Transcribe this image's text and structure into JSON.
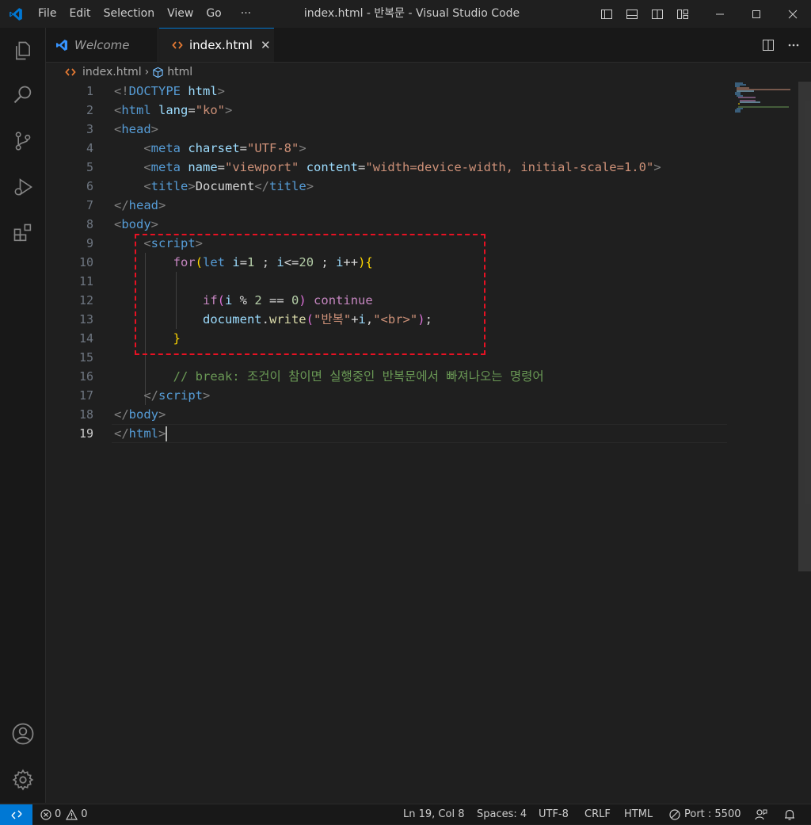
{
  "menu": {
    "file": "File",
    "edit": "Edit",
    "selection": "Selection",
    "view": "View",
    "go": "Go",
    "more": "···"
  },
  "window_title": "index.html - 반복문 - Visual Studio Code",
  "tabs": {
    "welcome": "Welcome",
    "index": "index.html",
    "close": "✕"
  },
  "breadcrumb": {
    "file": "index.html",
    "sep": "›",
    "symbol": "html"
  },
  "line_numbers": [
    "1",
    "2",
    "3",
    "4",
    "5",
    "6",
    "7",
    "8",
    "9",
    "10",
    "11",
    "12",
    "13",
    "14",
    "15",
    "16",
    "17",
    "18",
    "19"
  ],
  "code": {
    "l1": {
      "open": "<!",
      "doctype": "DOCTYPE",
      "html": "html",
      "close": ">"
    },
    "l2": {
      "open": "<",
      "tag": "html",
      "attr": "lang",
      "eq": "=",
      "val": "\"ko\"",
      "close": ">"
    },
    "l3": {
      "open": "<",
      "tag": "head",
      "close": ">"
    },
    "l4": {
      "open": "<",
      "tag": "meta",
      "attr": "charset",
      "eq": "=",
      "val": "\"UTF-8\"",
      "close": ">"
    },
    "l5": {
      "open": "<",
      "tag": "meta",
      "attr1": "name",
      "eq": "=",
      "val1": "\"viewport\"",
      "attr2": "content",
      "val2": "\"width=device-width, initial-scale=1.0\"",
      "close": ">"
    },
    "l6": {
      "open": "<",
      "tag": "title",
      "close": ">",
      "text": "Document",
      "open2": "</",
      "close2": ">"
    },
    "l7": {
      "open": "</",
      "tag": "head",
      "close": ">"
    },
    "l8": {
      "open": "<",
      "tag": "body",
      "close": ">"
    },
    "l9": {
      "open": "<",
      "tag": "script",
      "close": ">"
    },
    "l10": {
      "kw": "for",
      "lp": "(",
      "let": "let",
      "var": "i",
      "eq": "=",
      "n1": "1",
      "sep": " ; ",
      "var2": "i",
      "lte": "<=",
      "n2": "20",
      "sep2": " ; ",
      "var3": "i",
      "inc": "++",
      "rp": ")",
      "lb": "{"
    },
    "l12": {
      "kw": "if",
      "lp": "(",
      "var": "i",
      "mod": " % ",
      "n1": "2",
      "eq": " == ",
      "n2": "0",
      "rp": ")",
      "kw2": "continue"
    },
    "l13": {
      "obj": "document",
      "dot": ".",
      "fn": "write",
      "lp": "(",
      "s1": "\"반복\"",
      "plus": "+",
      "var": "i",
      "comma": ",",
      "s2": "\"<br>\"",
      "rp": ")",
      "semi": ";"
    },
    "l14": {
      "rb": "}"
    },
    "l16": {
      "comment": "// break: 조건이 참이면 실행중인 반복문에서 빠져나오는 명령어"
    },
    "l17": {
      "open": "</",
      "tag": "script",
      "close": ">"
    },
    "l18": {
      "open": "</",
      "tag": "body",
      "close": ">"
    },
    "l19": {
      "open": "</",
      "tag": "html",
      "close": ">"
    }
  },
  "status": {
    "errors": "0",
    "warnings": "0",
    "position": "Ln 19, Col 8",
    "spaces": "Spaces: 4",
    "encoding": "UTF-8",
    "eol": "CRLF",
    "language": "HTML",
    "port": "Port : 5500"
  },
  "colors": {
    "accent": "#0078d4",
    "highlight_box": "#e81123",
    "html_icon": "#e37933"
  }
}
